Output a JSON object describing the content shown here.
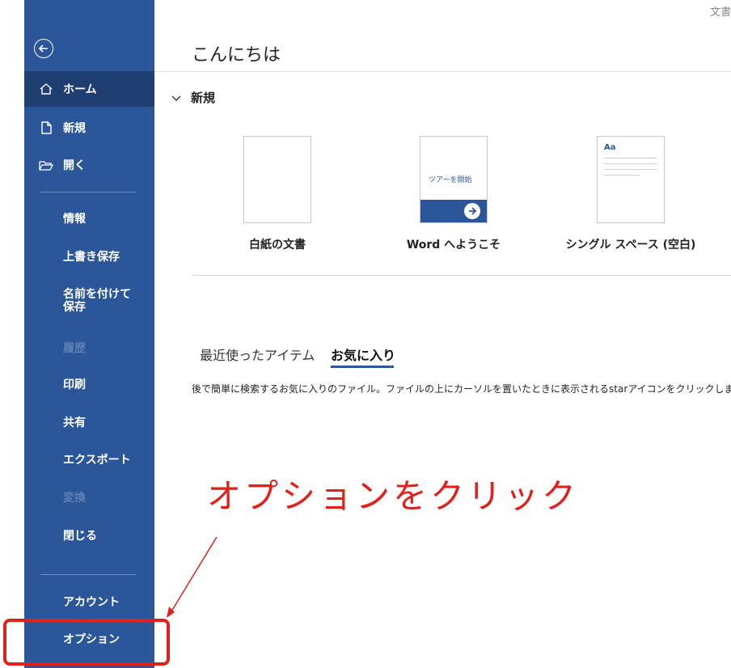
{
  "window": {
    "title_fragment": "文書"
  },
  "sidebar": {
    "items": [
      {
        "label": "ホーム",
        "icon": "home-icon"
      },
      {
        "label": "新規",
        "icon": "new-document-icon"
      },
      {
        "label": "開く",
        "icon": "open-folder-icon"
      },
      {
        "label": "情報"
      },
      {
        "label": "上書き保存"
      },
      {
        "label": "名前を付けて保存"
      },
      {
        "label": "履歴",
        "disabled": true
      },
      {
        "label": "印刷"
      },
      {
        "label": "共有"
      },
      {
        "label": "エクスポート"
      },
      {
        "label": "変換",
        "disabled": true
      },
      {
        "label": "閉じる"
      },
      {
        "label": "アカウント"
      },
      {
        "label": "オプション"
      }
    ],
    "back_icon": "back-arrow-icon",
    "colors": {
      "background": "#2b579a",
      "active": "#1f3f72"
    }
  },
  "main": {
    "greeting": "こんにちは",
    "new_section": {
      "title": "新規",
      "chevron": "chevron-down-icon"
    },
    "templates": [
      {
        "label": "白紙の文書"
      },
      {
        "label": "Word へようこそ",
        "thumb_text": "ツアーを開始"
      },
      {
        "label": "シングル スペース (空白)",
        "thumb_text": "Aa"
      }
    ],
    "tabs": [
      {
        "label": "最近使ったアイテム",
        "active": false
      },
      {
        "label": "お気に入り",
        "active": true
      }
    ],
    "favorites_description": "後で簡単に検索するお気に入りのファイル。ファイルの上にカーソルを置いたときに表示されるstarアイコンをクリックします。"
  },
  "annotation": {
    "text": "オプションをクリック",
    "color": "#e0201a"
  }
}
